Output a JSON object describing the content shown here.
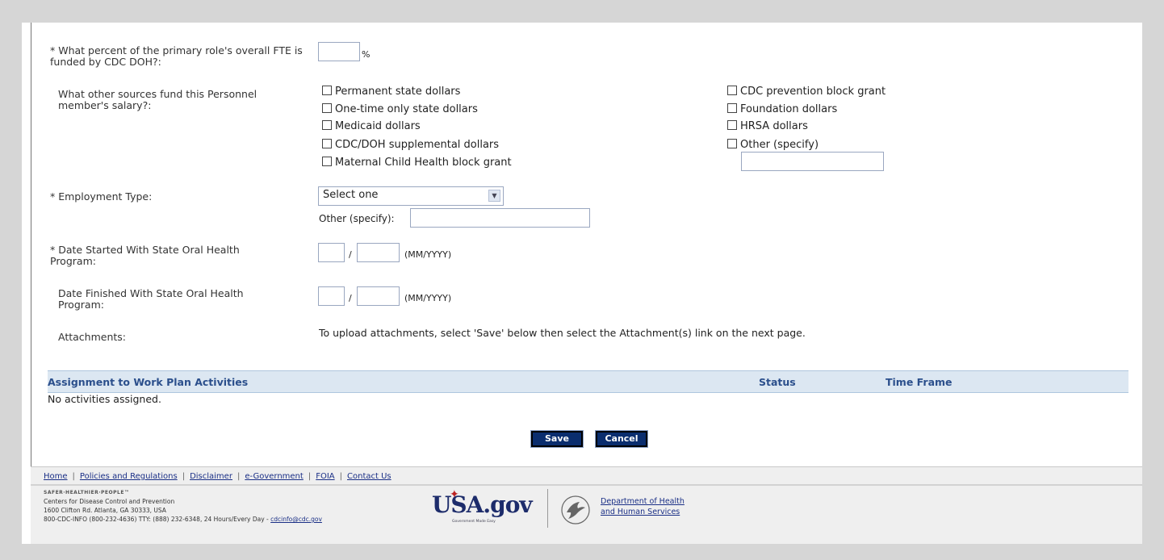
{
  "form": {
    "fte_label": "* What percent of the primary role's overall FTE is funded by CDC DOH?:",
    "fte_value": "",
    "fte_unit": "%",
    "sources_label": "What other sources fund this Personnel member's salary?:",
    "sources_left": [
      {
        "label": "Permanent state dollars",
        "checked": false
      },
      {
        "label": "One-time only state dollars",
        "checked": false
      },
      {
        "label": "Medicaid dollars",
        "checked": false
      },
      {
        "label": "CDC/DOH supplemental dollars",
        "checked": false
      },
      {
        "label": "Maternal Child Health block grant",
        "checked": false
      }
    ],
    "sources_right": [
      {
        "label": "CDC prevention block grant",
        "checked": false
      },
      {
        "label": "Foundation dollars",
        "checked": false
      },
      {
        "label": "HRSA dollars",
        "checked": false
      },
      {
        "label": "Other (specify)",
        "checked": false
      }
    ],
    "sources_other_value": "",
    "employment_label": "* Employment Type:",
    "employment_selected": "Select one",
    "employment_other_label": "Other (specify):",
    "employment_other_value": "",
    "date_started_label": "* Date Started With State Oral Health Program:",
    "date_finished_label": "Date Finished With State Oral Health Program:",
    "date_sep": "/",
    "date_format": "(MM/YYYY)",
    "attachments_label": "Attachments:",
    "attachments_text": "To upload attachments, select 'Save' below then select the Attachment(s) link on the next page."
  },
  "assignments": {
    "header": "Assignment to Work Plan Activities",
    "status_header": "Status",
    "timeframe_header": "Time Frame",
    "empty_text": "No activities assigned."
  },
  "buttons": {
    "save": "Save",
    "cancel": "Cancel"
  },
  "footer": {
    "links": [
      "Home",
      "Policies and Regulations",
      "Disclaimer",
      "e-Government",
      "FOIA",
      "Contact Us"
    ],
    "tagline": "SAFER·HEALTHIER·PEOPLE™",
    "org": "Centers for Disease Control and Prevention",
    "address": "1600 Clifton Rd. Atlanta, GA 30333, USA",
    "contact_prefix": "800-CDC-INFO (800-232-4636) TTY: (888) 232-6348, 24 Hours/Every Day - ",
    "email": "cdcinfo@cdc.gov",
    "usa_logo_text": "USA.gov",
    "usa_logo_sub": "Government Made Easy",
    "hhs_line1": "Department of Health",
    "hhs_line2": "and Human Services"
  },
  "colors": {
    "button_bg": "#0a2d6e",
    "header_bg": "#dce7f2",
    "header_text": "#2b4f8c",
    "link": "#1a2f86"
  }
}
